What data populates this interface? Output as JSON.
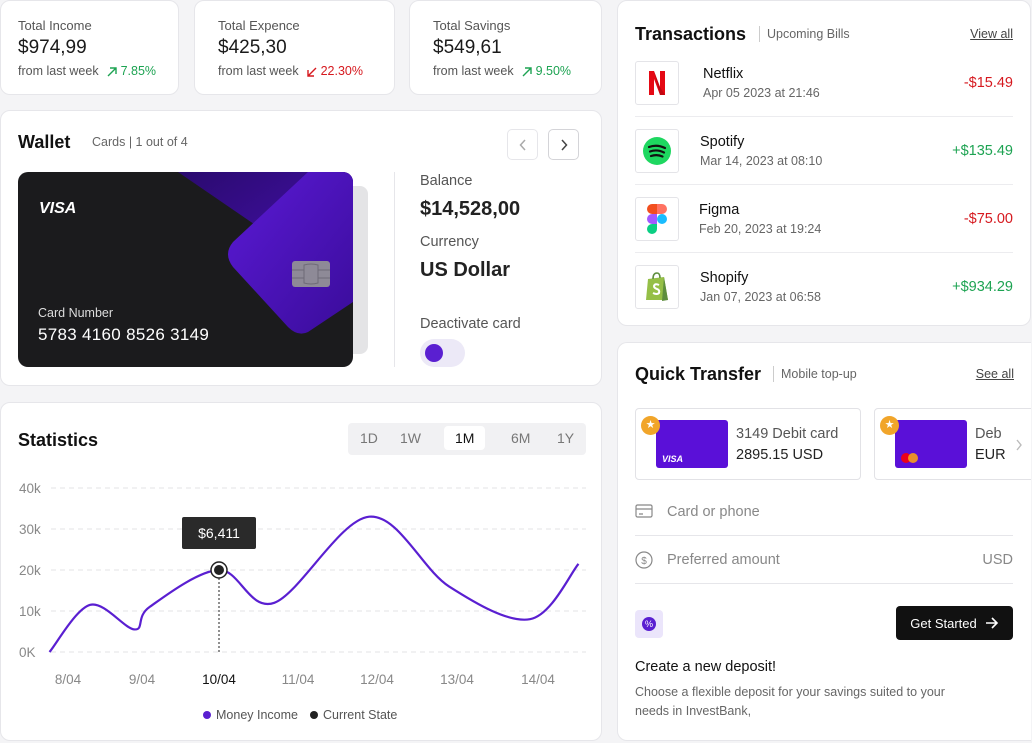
{
  "stats": [
    {
      "label": "Total Income",
      "value": "$974,99",
      "period": "from last week",
      "change": "7.85%",
      "trend": "up"
    },
    {
      "label": "Total Expence",
      "value": "$425,30",
      "period": "from last week",
      "change": "22.30%",
      "trend": "down"
    },
    {
      "label": "Total Savings",
      "value": "$549,61",
      "period": "from last week",
      "change": "9.50%",
      "trend": "up"
    }
  ],
  "wallet": {
    "title": "Wallet",
    "subtitle": "Cards",
    "count": "1 out of 4",
    "card": {
      "brand": "VISA",
      "number_label": "Card Number",
      "number": "5783 4160 8526 3149"
    },
    "balance_label": "Balance",
    "balance": "$14,528,00",
    "currency_label": "Currency",
    "currency": "US Dollar",
    "deactivate_label": "Deactivate card",
    "deactivate_on": true
  },
  "statistics": {
    "title": "Statistics",
    "ranges": [
      "1D",
      "1W",
      "1M",
      "6M",
      "1Y"
    ],
    "active_range": "1M",
    "tooltip": "$6,411",
    "legend": [
      "Money Income",
      "Current State"
    ]
  },
  "chart_data": {
    "type": "line",
    "x_ticks": [
      "8/04",
      "9/04",
      "10/04",
      "11/04",
      "12/04",
      "13/04",
      "14/04"
    ],
    "highlighted_tick": "10/04",
    "y_ticks": [
      "0K",
      "10k",
      "20k",
      "30k",
      "40k"
    ],
    "ylim": [
      0,
      40000
    ],
    "grid": true,
    "legend_position": "bottom",
    "series": [
      {
        "name": "Money Income",
        "color": "#5a1fd1",
        "x": [
          7.75,
          8.3,
          8.9,
          9.1,
          10.0,
          10.7,
          11.9,
          12.9,
          13.9,
          14.5
        ],
        "values": [
          0,
          11500,
          5500,
          11000,
          20000,
          12000,
          33000,
          16000,
          8000,
          21500
        ]
      }
    ],
    "annotation": {
      "x": 10.0,
      "y": 20000,
      "label": "$6,411",
      "series": "Current State"
    }
  },
  "transactions": {
    "title": "Transactions",
    "subtitle": "Upcoming Bills",
    "view_all": "View all",
    "items": [
      {
        "name": "Netflix",
        "date": "Apr 05 2023 at 21:46",
        "amount": "-$15.49",
        "type": "debit",
        "icon": "netflix-icon"
      },
      {
        "name": "Spotify",
        "date": "Mar 14, 2023 at 08:10",
        "amount": "+$135.49",
        "type": "credit",
        "icon": "spotify-icon"
      },
      {
        "name": "Figma",
        "date": "Feb 20, 2023 at 19:24",
        "amount": "-$75.00",
        "type": "debit",
        "icon": "figma-icon"
      },
      {
        "name": "Shopify",
        "date": "Jan 07, 2023 at 06:58",
        "amount": "+$934.29",
        "type": "credit",
        "icon": "shopify-icon"
      }
    ]
  },
  "quick_transfer": {
    "title": "Quick Transfer",
    "subtitle": "Mobile top-up",
    "see_all": "See all",
    "cards": [
      {
        "title": "3149 Debit card",
        "amount": "2895.15 USD",
        "brand": "VISA"
      },
      {
        "title": "Deb",
        "amount": "EUR",
        "brand": "mastercard"
      }
    ],
    "card_placeholder": "Card or phone",
    "amount_placeholder": "Preferred amount",
    "amount_currency": "USD",
    "cta": "Get Started",
    "deposit_title": "Create a new deposit!",
    "deposit_text": "Choose a flexible deposit for your savings suited to your needs in InvestBank,"
  },
  "colors": {
    "accent": "#5a1fd1",
    "positive": "#1da352",
    "negative": "#d6191f",
    "dark": "#111111"
  }
}
